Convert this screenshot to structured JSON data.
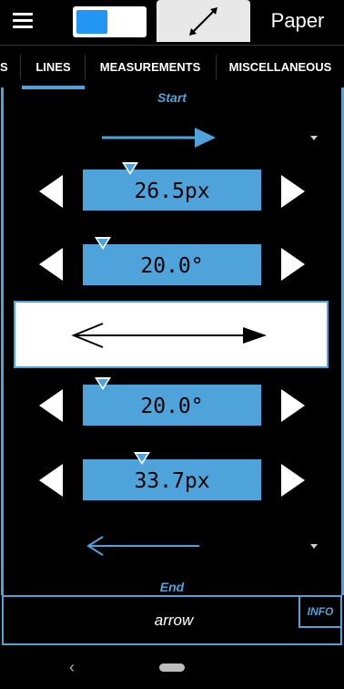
{
  "app_bar": {
    "menu_icon": "hamburger-menu-icon",
    "selected_color": "#2196f3",
    "line_tool_icon": "diagonal-double-arrow-icon",
    "paper_label": "Paper"
  },
  "tabs": [
    {
      "label": "S"
    },
    {
      "label": "LINES",
      "selected": true
    },
    {
      "label": "MEASUREMENTS"
    },
    {
      "label": "MISCELLANEOUS"
    }
  ],
  "start": {
    "label": "Start",
    "arrow_style": "right-arrow",
    "length": "26.5px",
    "angle": "20.0°"
  },
  "end": {
    "label": "End",
    "arrow_style": "left-arrow",
    "angle": "20.0°",
    "length": "33.7px"
  },
  "bottom": {
    "type_label": "arrow",
    "info_label": "INFO"
  },
  "colors": {
    "accent": "#4fa3db",
    "background": "#000000"
  }
}
